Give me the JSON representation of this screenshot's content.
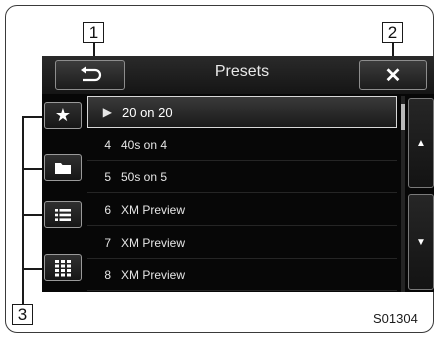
{
  "callouts": [
    "1",
    "2",
    "3"
  ],
  "header": {
    "title": "Presets",
    "back_icon": "return-arrow-icon",
    "close_icon": "close-x-icon",
    "close_glyph": "✕"
  },
  "side_buttons": [
    {
      "icon": "star-icon",
      "glyph": "★"
    },
    {
      "icon": "folder-icon"
    },
    {
      "icon": "list-icon"
    },
    {
      "icon": "keypad-grid-icon"
    }
  ],
  "presets": [
    {
      "number": "▶",
      "name": "20 on 20",
      "selected": true
    },
    {
      "number": "4",
      "name": "40s on 4",
      "selected": false
    },
    {
      "number": "5",
      "name": "50s on 5",
      "selected": false
    },
    {
      "number": "6",
      "name": "XM Preview",
      "selected": false
    },
    {
      "number": "7",
      "name": "XM Preview",
      "selected": false
    },
    {
      "number": "8",
      "name": "XM Preview",
      "selected": false
    }
  ],
  "scroll": {
    "up_glyph": "▲",
    "down_glyph": "▼"
  },
  "figure_code": "S01304",
  "colors": {
    "screen_bg": "#070707",
    "button_border": "#9a9a9a",
    "text": "#e6e6e6"
  }
}
